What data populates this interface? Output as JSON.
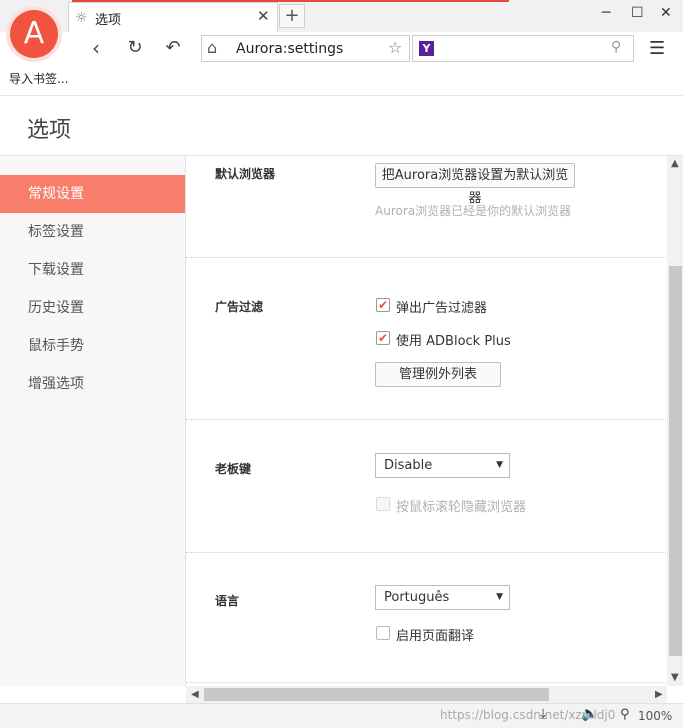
{
  "tab": {
    "title": "选项"
  },
  "window": {
    "minimize_icon": "minimize-icon",
    "maximize_icon": "maximize-icon",
    "close_icon": "close-icon"
  },
  "logo": {
    "letter": "A"
  },
  "import_bookmarks": "导入书签...",
  "toolbar": {
    "url": "Aurora:settings",
    "search_engine_letter": "Y",
    "search_placeholder": ""
  },
  "page": {
    "title": "选项"
  },
  "sidebar": {
    "items": [
      {
        "label": "常规设置",
        "active": true
      },
      {
        "label": "标签设置",
        "active": false
      },
      {
        "label": "下载设置",
        "active": false
      },
      {
        "label": "历史设置",
        "active": false
      },
      {
        "label": "鼠标手势",
        "active": false
      },
      {
        "label": "增强选项",
        "active": false
      }
    ]
  },
  "sections": {
    "default_browser": {
      "label": "默认浏览器",
      "button": "把Aurora浏览器设置为默认浏览器",
      "hint": "Aurora浏览器已经是你的默认浏览器"
    },
    "adfilter": {
      "label": "广告过滤",
      "popup_filter": {
        "label": "弹出广告过滤器",
        "checked": true
      },
      "adblock": {
        "label": "使用 ADBlock Plus",
        "checked": true
      },
      "manage_button": "管理例外列表"
    },
    "boss_key": {
      "label": "老板键",
      "select_value": "Disable",
      "wheel_hide": {
        "label": "按鼠标滚轮隐藏浏览器",
        "checked": false,
        "disabled": true
      }
    },
    "language": {
      "label": "语言",
      "select_value": "Português",
      "translate": {
        "label": "启用页面翻译",
        "checked": false
      }
    }
  },
  "status": {
    "watermark": "https://blog.csdn.net/xzmldj0",
    "zoom": "100%"
  },
  "colors": {
    "accent": "#f97d6b",
    "logo": "#f0533f",
    "check": "#e2533f"
  }
}
